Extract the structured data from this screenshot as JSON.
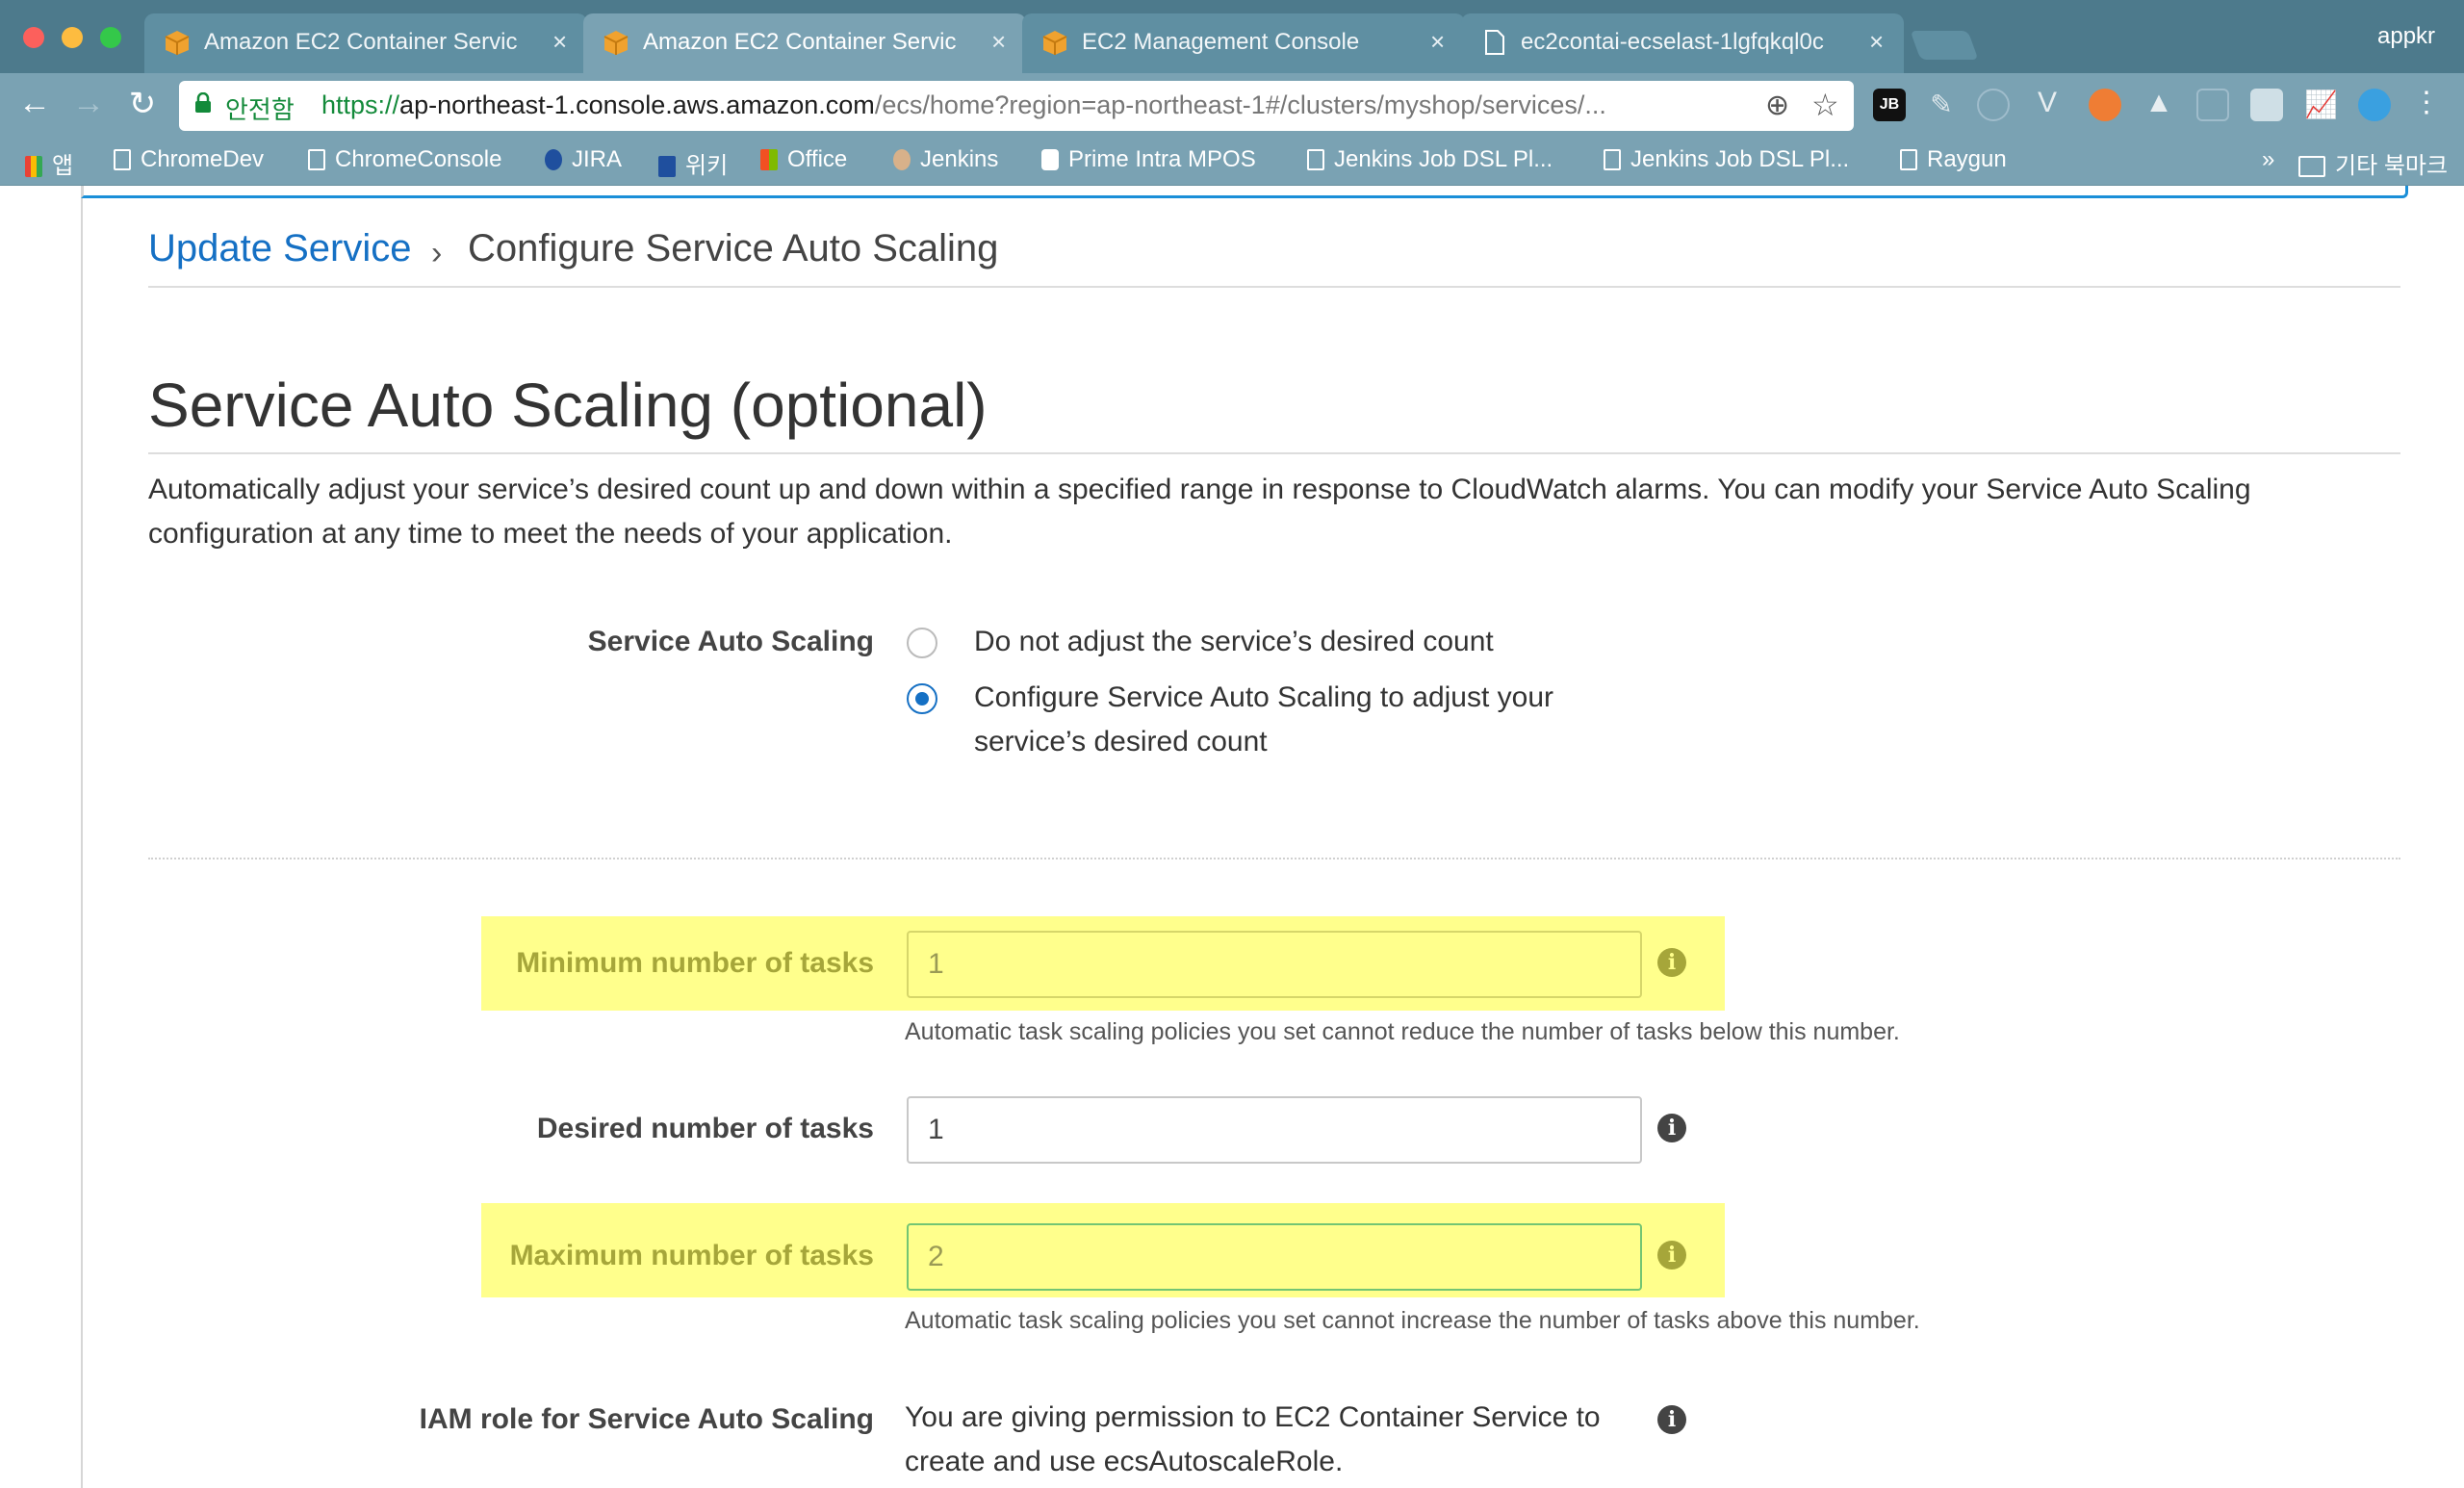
{
  "browser": {
    "tabs": [
      {
        "title": "Amazon EC2 Container Servic",
        "close": "×",
        "active": false
      },
      {
        "title": "Amazon EC2 Container Servic",
        "close": "×",
        "active": true
      },
      {
        "title": "EC2 Management Console",
        "close": "×",
        "active": false
      },
      {
        "title": "ec2contai-ecselast-1lgfqkql0c",
        "close": "×",
        "active": false
      }
    ],
    "profile": "appkr",
    "secure_label": "안전함",
    "url_scheme": "https://",
    "url_host": "ap-northeast-1.console.aws.amazon.com",
    "url_path": "/ecs/home?region=ap-northeast-1#/clusters/myshop/services/...",
    "bookmarks": [
      {
        "label": "앱"
      },
      {
        "label": "ChromeDev"
      },
      {
        "label": "ChromeConsole"
      },
      {
        "label": "JIRA"
      },
      {
        "label": "위키"
      },
      {
        "label": "Office"
      },
      {
        "label": "Jenkins"
      },
      {
        "label": "Prime Intra MPOS"
      },
      {
        "label": "Jenkins Job DSL Pl..."
      },
      {
        "label": "Jenkins Job DSL Pl..."
      },
      {
        "label": "Raygun"
      }
    ],
    "overflow": "»",
    "other_bookmarks": "기타 북마크",
    "icons": {
      "back": "back-arrow-icon",
      "forward": "forward-arrow-icon",
      "reload": "reload-icon",
      "zoom": "zoom-icon",
      "star": "bookmark-star-icon"
    },
    "colors": {
      "chrome": "#4d7a8c",
      "toolbar": "#7aa2b3"
    }
  },
  "page": {
    "breadcrumb_link": "Update Service",
    "breadcrumb_sep": "›",
    "breadcrumb_current": "Configure Service Auto Scaling",
    "title": "Service Auto Scaling (optional)",
    "description": "Automatically adjust your service’s desired count up and down within a specified range in response to CloudWatch alarms. You can modify your Service Auto Scaling configuration at any time to meet the needs of your application.",
    "scaling": {
      "label": "Service Auto Scaling",
      "option_off": "Do not adjust the service’s desired count",
      "option_on": "Configure Service Auto Scaling to adjust your service’s desired count",
      "selected": "option_on"
    },
    "min_tasks": {
      "label": "Minimum number of tasks",
      "value": "1",
      "hint": "Automatic task scaling policies you set cannot reduce the number of tasks below this number."
    },
    "desired_tasks": {
      "label": "Desired number of tasks",
      "value": "1"
    },
    "max_tasks": {
      "label": "Maximum number of tasks",
      "value": "2",
      "hint": "Automatic task scaling policies you set cannot increase the number of tasks above this number."
    },
    "iam": {
      "label": "IAM role for Service Auto Scaling",
      "text": "You are giving permission to EC2 Container Service to create and use ecsAutoscaleRole."
    },
    "info_glyph": "i",
    "colors": {
      "link": "#1570c4",
      "highlight": "#ffff8c",
      "radio": "#1570c4"
    }
  }
}
